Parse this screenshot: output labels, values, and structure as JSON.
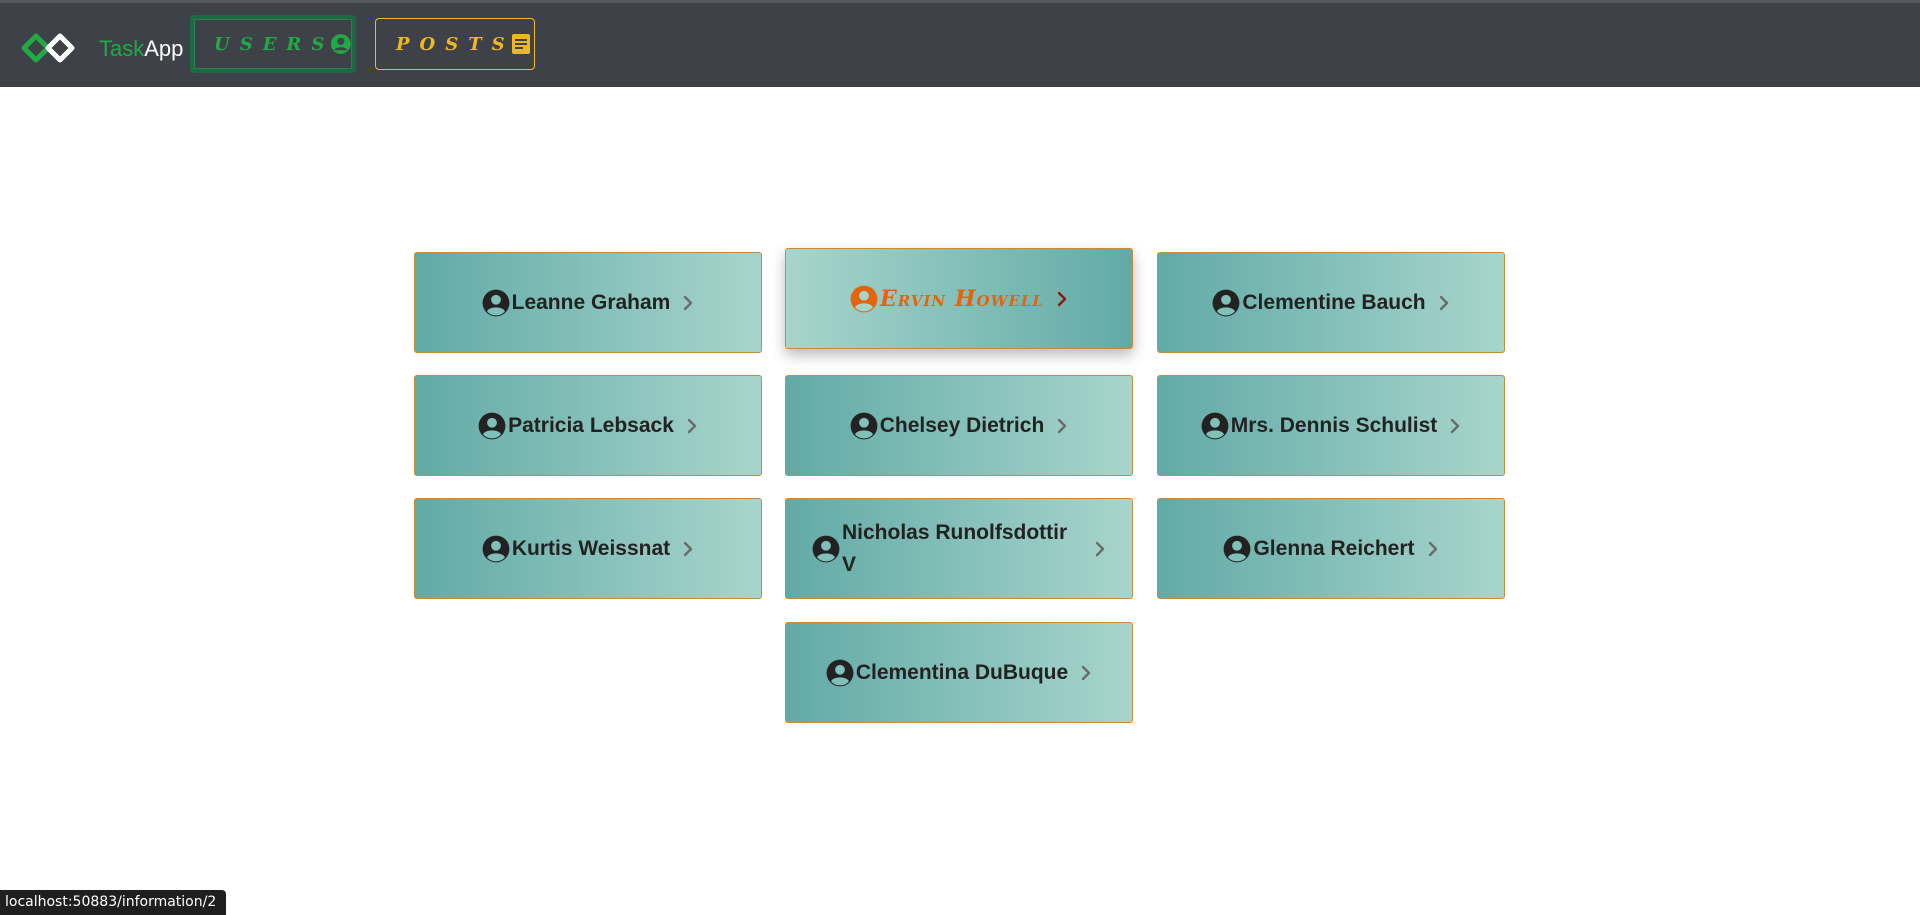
{
  "header": {
    "brand_task": "Task",
    "brand_app": "App",
    "nav": {
      "users_label": "Users",
      "posts_label": "Posts"
    },
    "colors": {
      "background": "#3e4147",
      "users": "#1faa45",
      "posts": "#f0b820"
    }
  },
  "users": [
    {
      "name": "Leanne Graham"
    },
    {
      "name": "Ervin Howell",
      "hovered": true
    },
    {
      "name": "Clementine Bauch"
    },
    {
      "name": "Patricia Lebsack"
    },
    {
      "name": "Chelsey Dietrich"
    },
    {
      "name": "Mrs. Dennis Schulist"
    },
    {
      "name": "Kurtis Weissnat"
    },
    {
      "name": "Nicholas Runolfsdottir V"
    },
    {
      "name": "Glenna Reichert"
    },
    {
      "name": "Clementina DuBuque"
    }
  ],
  "icons": {
    "user": "user-circle-icon",
    "chevron": "chevron-right-icon",
    "posts": "note-icon",
    "logo": "infinity-logo"
  },
  "status_url": "localhost:50883/information/2"
}
